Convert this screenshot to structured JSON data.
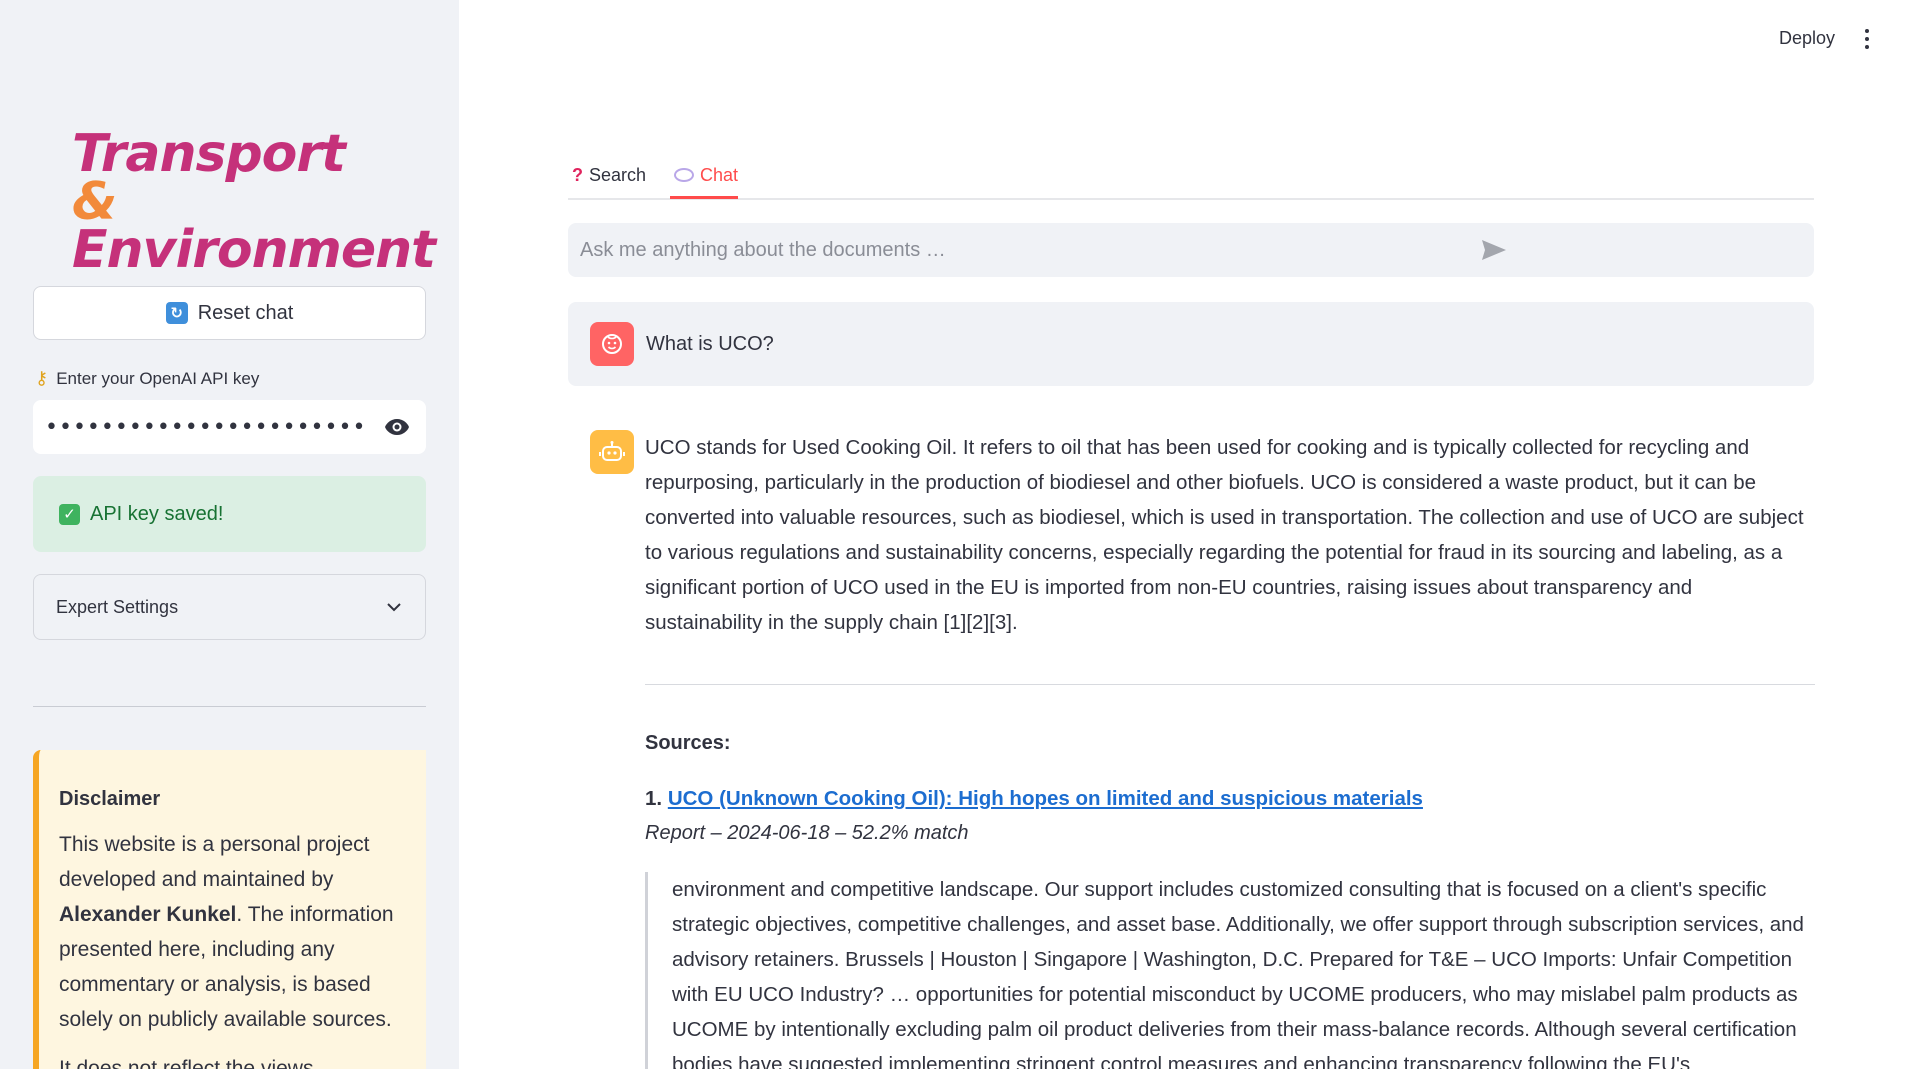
{
  "sidebar": {
    "logo": {
      "line1": "Transport ",
      "amp": "&",
      "line2": "Environment"
    },
    "reset_button": "Reset chat",
    "api_key_label": "Enter your OpenAI API key",
    "api_key_value": "•••••••••••••••••••••••",
    "api_success": "API key saved!",
    "expert_settings": "Expert Settings",
    "disclaimer": {
      "title": "Disclaimer",
      "text_before": "This website is a personal project developed and maintained by ",
      "author": "Alexander Kunkel",
      "text_after": ". The information presented here, including any commentary or analysis, is based solely on publicly available sources.",
      "text_more": "It does not reflect the views, policies..."
    }
  },
  "header": {
    "deploy": "Deploy"
  },
  "main": {
    "tabs": [
      {
        "label": "Search",
        "icon": "question-icon"
      },
      {
        "label": "Chat",
        "icon": "speech-bubble-icon"
      }
    ],
    "chat_input_placeholder": "Ask me anything about the documents …",
    "user_message": "What is UCO?",
    "assistant_answer": "UCO stands for Used Cooking Oil. It refers to oil that has been used for cooking and is typically collected for recycling and repurposing, particularly in the production of biodiesel and other biofuels. UCO is considered a waste product, but it can be converted into valuable resources, such as biodiesel, which is used in transportation. The collection and use of UCO are subject to various regulations and sustainability concerns, especially regarding the potential for fraud in its sourcing and labeling, as a significant portion of UCO used in the EU is imported from non-EU countries, raising issues about transparency and sustainability in the supply chain [1][2][3].",
    "sources_title": "Sources:",
    "sources": [
      {
        "number": "1.",
        "title": "UCO (Unknown Cooking Oil): High hopes on limited and suspicious materials",
        "meta": "Report – 2024-06-18 – 52.2% match",
        "excerpt": "environment and competitive landscape. Our support includes customized consulting that is focused on a client's specific strategic objectives, competitive challenges, and asset base. Additionally, we offer support through subscription services, and advisory retainers. Brussels | Houston | Singapore | Washington, D.C. Prepared for T&E – UCO Imports: Unfair Competition with EU UCO Industry? … opportunities for potential misconduct by UCOME producers, who may mislabel palm products as UCOME by intentionally excluding palm oil product deliveries from their mass-balance records. Although several certification bodies have suggested implementing stringent control measures and enhancing transparency following the EU's"
      }
    ]
  },
  "colors": {
    "accent": "#ff4b4b",
    "sidebar_bg": "#f0f2f6",
    "success_bg": "#dbefe3",
    "warning_border": "#f6a623",
    "link": "#1c6dd0",
    "logo_magenta": "#c5317a",
    "logo_orange": "#f28a3b"
  }
}
